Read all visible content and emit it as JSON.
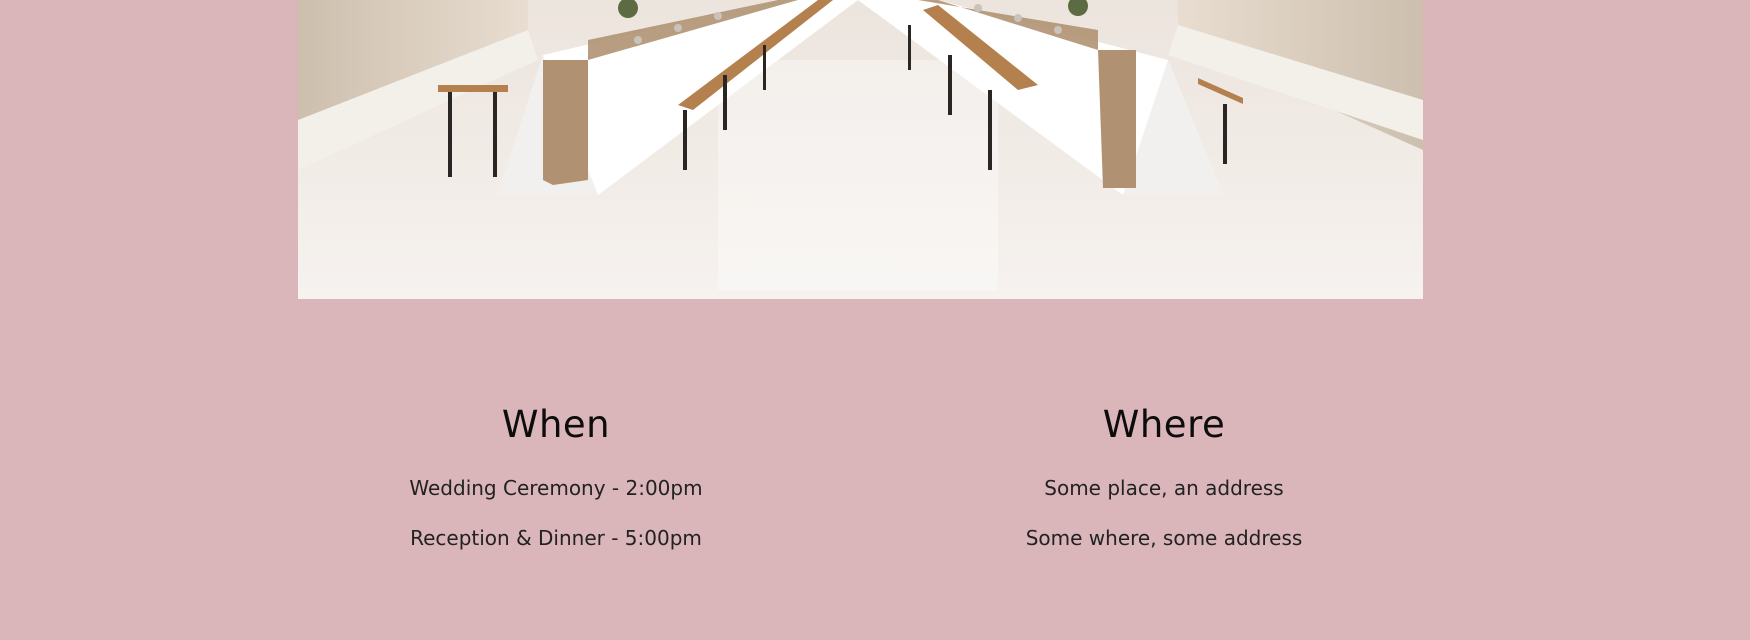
{
  "hero_image": {
    "description_name": "venue-photo"
  },
  "details": {
    "when": {
      "heading": "When",
      "lines": [
        "Wedding Ceremony - 2:00pm",
        "Reception & Dinner - 5:00pm"
      ]
    },
    "where": {
      "heading": "Where",
      "lines": [
        "Some place, an address",
        "Some where, some address"
      ]
    }
  },
  "colors": {
    "page_background": "#dab5b9",
    "heading_text": "#0c0c0c",
    "body_text": "#222222"
  }
}
